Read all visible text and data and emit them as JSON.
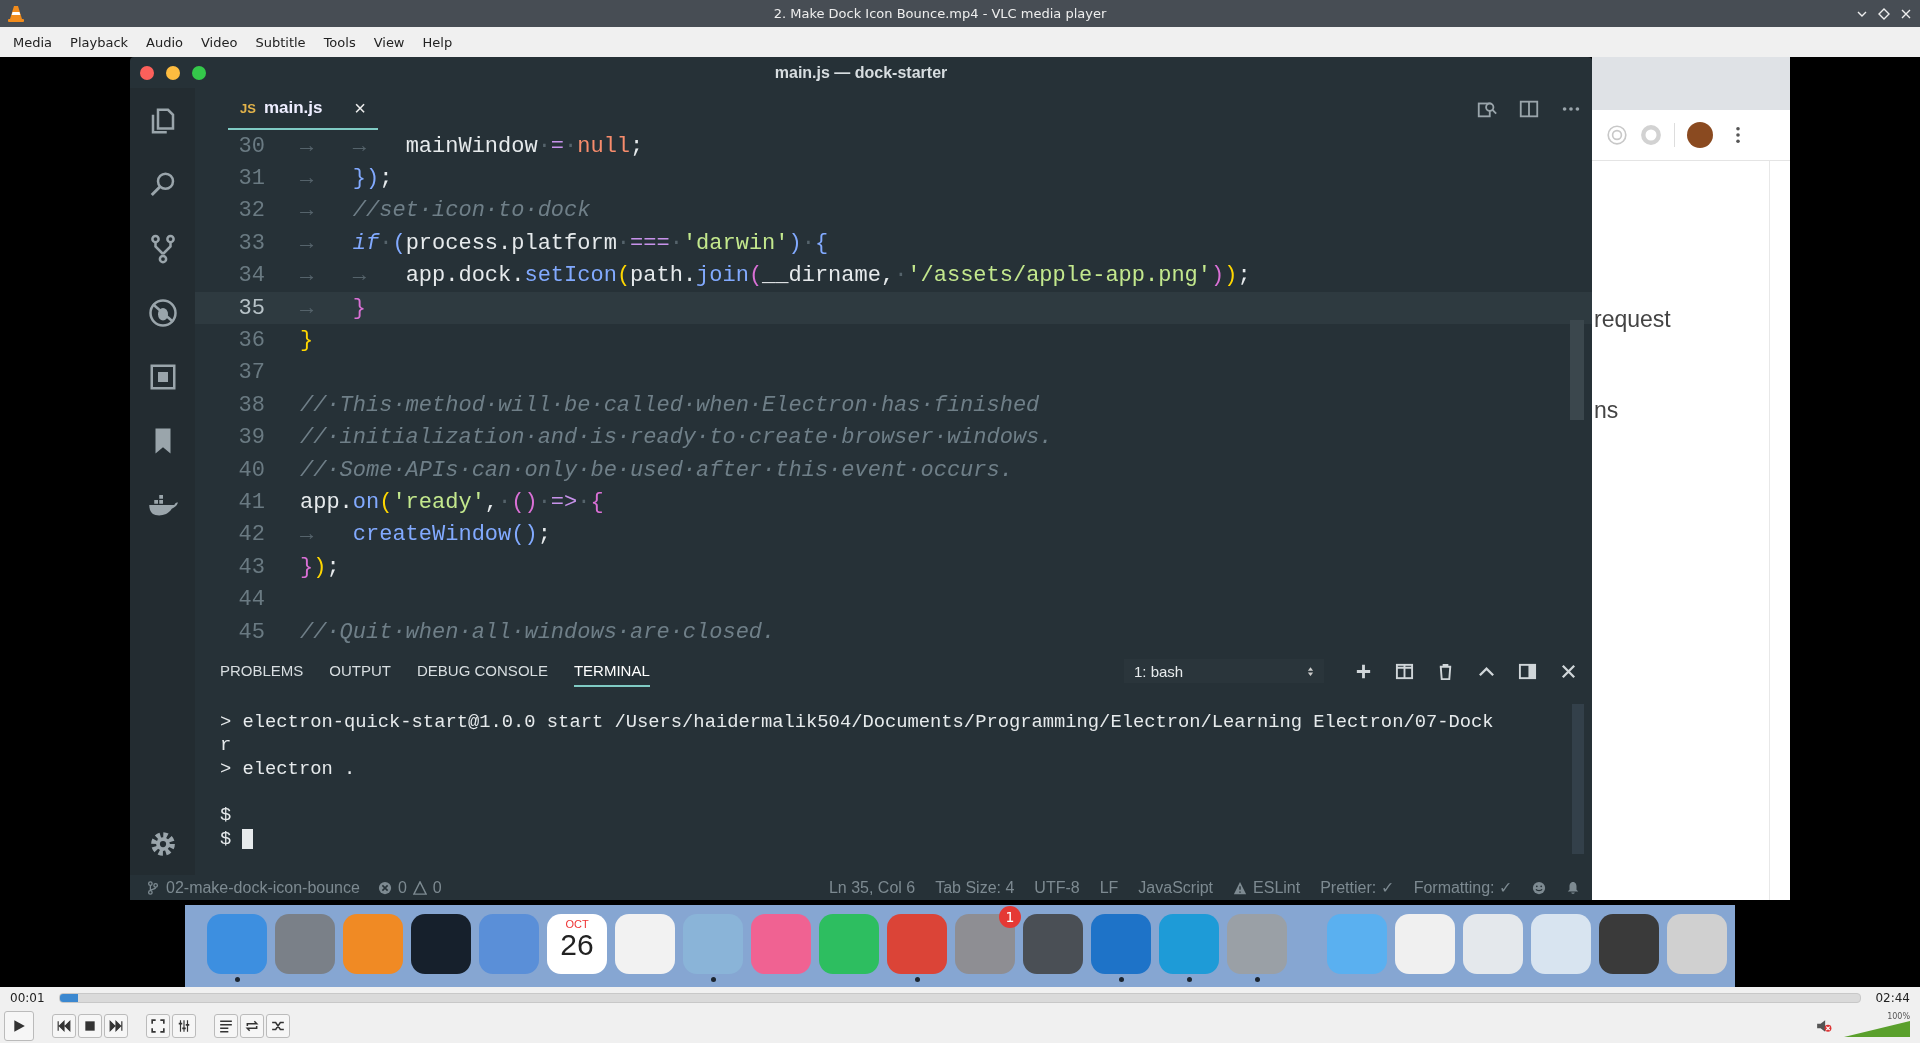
{
  "window": {
    "title": "2. Make Dock Icon Bounce.mp4 - VLC media player"
  },
  "menu": [
    "Media",
    "Playback",
    "Audio",
    "Video",
    "Subtitle",
    "Tools",
    "View",
    "Help"
  ],
  "editor": {
    "title": "main.js — dock-starter",
    "tabs": [
      {
        "badge": "JS",
        "label": "main.js",
        "close": "×",
        "selected": true
      }
    ],
    "lines": [
      {
        "number": "30",
        "current": false,
        "tokens": [
          {
            "t": "→   →   ",
            "kind": "ws"
          },
          {
            "t": "mainWindow",
            "kind": "id"
          },
          {
            "t": "·",
            "kind": "ws"
          },
          {
            "t": "=",
            "kind": "op"
          },
          {
            "t": "·",
            "kind": "ws"
          },
          {
            "t": "null",
            "kind": "lit"
          },
          {
            "t": ";",
            "kind": "id"
          }
        ]
      },
      {
        "number": "31",
        "current": false,
        "tokens": [
          {
            "t": "→   ",
            "kind": "ws"
          },
          {
            "t": "})",
            "kind": "br3"
          },
          {
            "t": ";",
            "kind": "id"
          }
        ]
      },
      {
        "number": "32",
        "current": false,
        "tokens": [
          {
            "t": "→   ",
            "kind": "ws"
          },
          {
            "t": "//set·icon·to·dock",
            "kind": "cm"
          }
        ]
      },
      {
        "number": "33",
        "current": false,
        "tokens": [
          {
            "t": "→   ",
            "kind": "ws"
          },
          {
            "t": "if",
            "kind": "kwi"
          },
          {
            "t": "·",
            "kind": "ws"
          },
          {
            "t": "(",
            "kind": "br3"
          },
          {
            "t": "process.platform",
            "kind": "id"
          },
          {
            "t": "·",
            "kind": "ws"
          },
          {
            "t": "===",
            "kind": "op"
          },
          {
            "t": "·",
            "kind": "ws"
          },
          {
            "t": "'darwin'",
            "kind": "str"
          },
          {
            "t": ")",
            "kind": "br3"
          },
          {
            "t": "·",
            "kind": "ws"
          },
          {
            "t": "{",
            "kind": "br3"
          }
        ]
      },
      {
        "number": "34",
        "current": false,
        "tokens": [
          {
            "t": "→   →   ",
            "kind": "ws"
          },
          {
            "t": "app.dock.",
            "kind": "id"
          },
          {
            "t": "setIcon",
            "kind": "fn"
          },
          {
            "t": "(",
            "kind": "br1"
          },
          {
            "t": "path.",
            "kind": "id"
          },
          {
            "t": "join",
            "kind": "fn"
          },
          {
            "t": "(",
            "kind": "br2"
          },
          {
            "t": "__dirname,",
            "kind": "id"
          },
          {
            "t": "·",
            "kind": "ws"
          },
          {
            "t": "'/assets/apple-app.png'",
            "kind": "str"
          },
          {
            "t": ")",
            "kind": "br2"
          },
          {
            "t": ")",
            "kind": "br1"
          },
          {
            "t": ";",
            "kind": "id"
          }
        ]
      },
      {
        "number": "35",
        "current": true,
        "tokens": [
          {
            "t": "→   ",
            "kind": "ws"
          },
          {
            "t": "}",
            "kind": "br2"
          }
        ]
      },
      {
        "number": "36",
        "current": false,
        "tokens": [
          {
            "t": "}",
            "kind": "br1"
          }
        ]
      },
      {
        "number": "37",
        "current": false
      },
      {
        "number": "38",
        "current": false,
        "tokens": [
          {
            "t": "//·This·method·will·be·called·when·Electron·has·finished",
            "kind": "cm"
          }
        ]
      },
      {
        "number": "39",
        "current": false,
        "tokens": [
          {
            "t": "//·initialization·and·is·ready·to·create·browser·windows.",
            "kind": "cm"
          }
        ]
      },
      {
        "number": "40",
        "current": false,
        "tokens": [
          {
            "t": "//·Some·APIs·can·only·be·used·after·this·event·occurs.",
            "kind": "cm"
          }
        ]
      },
      {
        "number": "41",
        "current": false,
        "tokens": [
          {
            "t": "app.",
            "kind": "id"
          },
          {
            "t": "on",
            "kind": "fn"
          },
          {
            "t": "(",
            "kind": "br1"
          },
          {
            "t": "'ready'",
            "kind": "str"
          },
          {
            "t": ",",
            "kind": "id"
          },
          {
            "t": "·",
            "kind": "ws"
          },
          {
            "t": "()",
            "kind": "br2"
          },
          {
            "t": "·",
            "kind": "ws"
          },
          {
            "t": "=>",
            "kind": "op"
          },
          {
            "t": "·",
            "kind": "ws"
          },
          {
            "t": "{",
            "kind": "br2"
          }
        ]
      },
      {
        "number": "42",
        "current": false,
        "tokens": [
          {
            "t": "→   ",
            "kind": "ws"
          },
          {
            "t": "createWindow",
            "kind": "fn"
          },
          {
            "t": "()",
            "kind": "br3"
          },
          {
            "t": ";",
            "kind": "id"
          }
        ]
      },
      {
        "number": "43",
        "current": false,
        "tokens": [
          {
            "t": "}",
            "kind": "br2"
          },
          {
            "t": ")",
            "kind": "br1"
          },
          {
            "t": ";",
            "kind": "id"
          }
        ]
      },
      {
        "number": "44",
        "current": false
      },
      {
        "number": "45",
        "current": false,
        "tokens": [
          {
            "t": "//·Quit·when·all·windows·are·closed.",
            "kind": "cm"
          }
        ]
      }
    ],
    "panel": {
      "tabs": [
        {
          "label": "PROBLEMS",
          "selected": false
        },
        {
          "label": "OUTPUT",
          "selected": false
        },
        {
          "label": "DEBUG CONSOLE",
          "selected": false
        },
        {
          "label": "TERMINAL",
          "selected": true
        }
      ],
      "terminal_select": "1: bash",
      "terminal_blocks": [
        [
          {
            "text": "> electron-quick-start@1.0.0 start /Users/haidermalik504/Documents/Programming/Electron/Learning Electron/07-Dock",
            "cursor": false
          },
          {
            "text": "r",
            "cursor": false
          },
          {
            "text": "> electron .",
            "cursor": false
          }
        ],
        [
          {
            "text": "$",
            "cursor": false
          },
          {
            "text": "$",
            "cursor": true
          }
        ]
      ]
    },
    "status": {
      "branch": "02-make-dock-icon-bounce",
      "errors": "0",
      "warnings": "0",
      "items": [
        "Ln 35, Col 6",
        "Tab Size: 4",
        "UTF-8",
        "LF",
        "JavaScript"
      ],
      "linter": "ESLint",
      "prettier": "Prettier: ✓",
      "formatting": "Formatting: ✓"
    }
  },
  "browser": {
    "texts": [
      "request",
      "ns"
    ]
  },
  "dock": {
    "apps": [
      {
        "kind": "app",
        "color": "#3d8fe0",
        "running": true
      },
      {
        "kind": "app",
        "color": "#7a8088",
        "running": false
      },
      {
        "kind": "app",
        "color": "#f08a24",
        "running": false
      },
      {
        "kind": "app",
        "color": "#16202c",
        "running": false
      },
      {
        "kind": "app",
        "color": "#5a8fd8",
        "running": false
      },
      {
        "kind": "calendar",
        "month": "OCT",
        "day": "26",
        "running": false
      },
      {
        "kind": "app",
        "color": "#f2f2f2",
        "running": false
      },
      {
        "kind": "app",
        "color": "#8ab4d8",
        "running": true
      },
      {
        "kind": "app",
        "color": "#f06292",
        "running": false
      },
      {
        "kind": "app",
        "color": "#2dbe60",
        "running": false
      },
      {
        "kind": "app",
        "color": "#db4437",
        "running": true
      },
      {
        "kind": "app",
        "color": "#8e8e93",
        "running": false,
        "badge": "1"
      },
      {
        "kind": "app",
        "color": "#4a4f55",
        "running": false
      },
      {
        "kind": "app",
        "color": "#1e73c8",
        "running": true
      },
      {
        "kind": "app",
        "color": "#1e9bd7",
        "running": true
      },
      {
        "kind": "app",
        "color": "#9aa0a6",
        "running": true
      }
    ],
    "others": [
      {
        "kind": "app",
        "color": "#5ab0f0",
        "running": false
      },
      {
        "kind": "app",
        "color": "#f0f0f0",
        "running": false
      },
      {
        "kind": "app",
        "color": "#e4e8ec",
        "running": false
      },
      {
        "kind": "app",
        "color": "#d8e4f0",
        "running": false
      },
      {
        "kind": "app",
        "color": "#3a3a3a",
        "running": false
      },
      {
        "kind": "app",
        "color": "#d0d0d0",
        "running": false
      }
    ]
  },
  "player": {
    "elapsed": "00:01",
    "total": "02:44",
    "level": 0.01,
    "volume": {
      "label": "100%",
      "level": 1
    }
  }
}
